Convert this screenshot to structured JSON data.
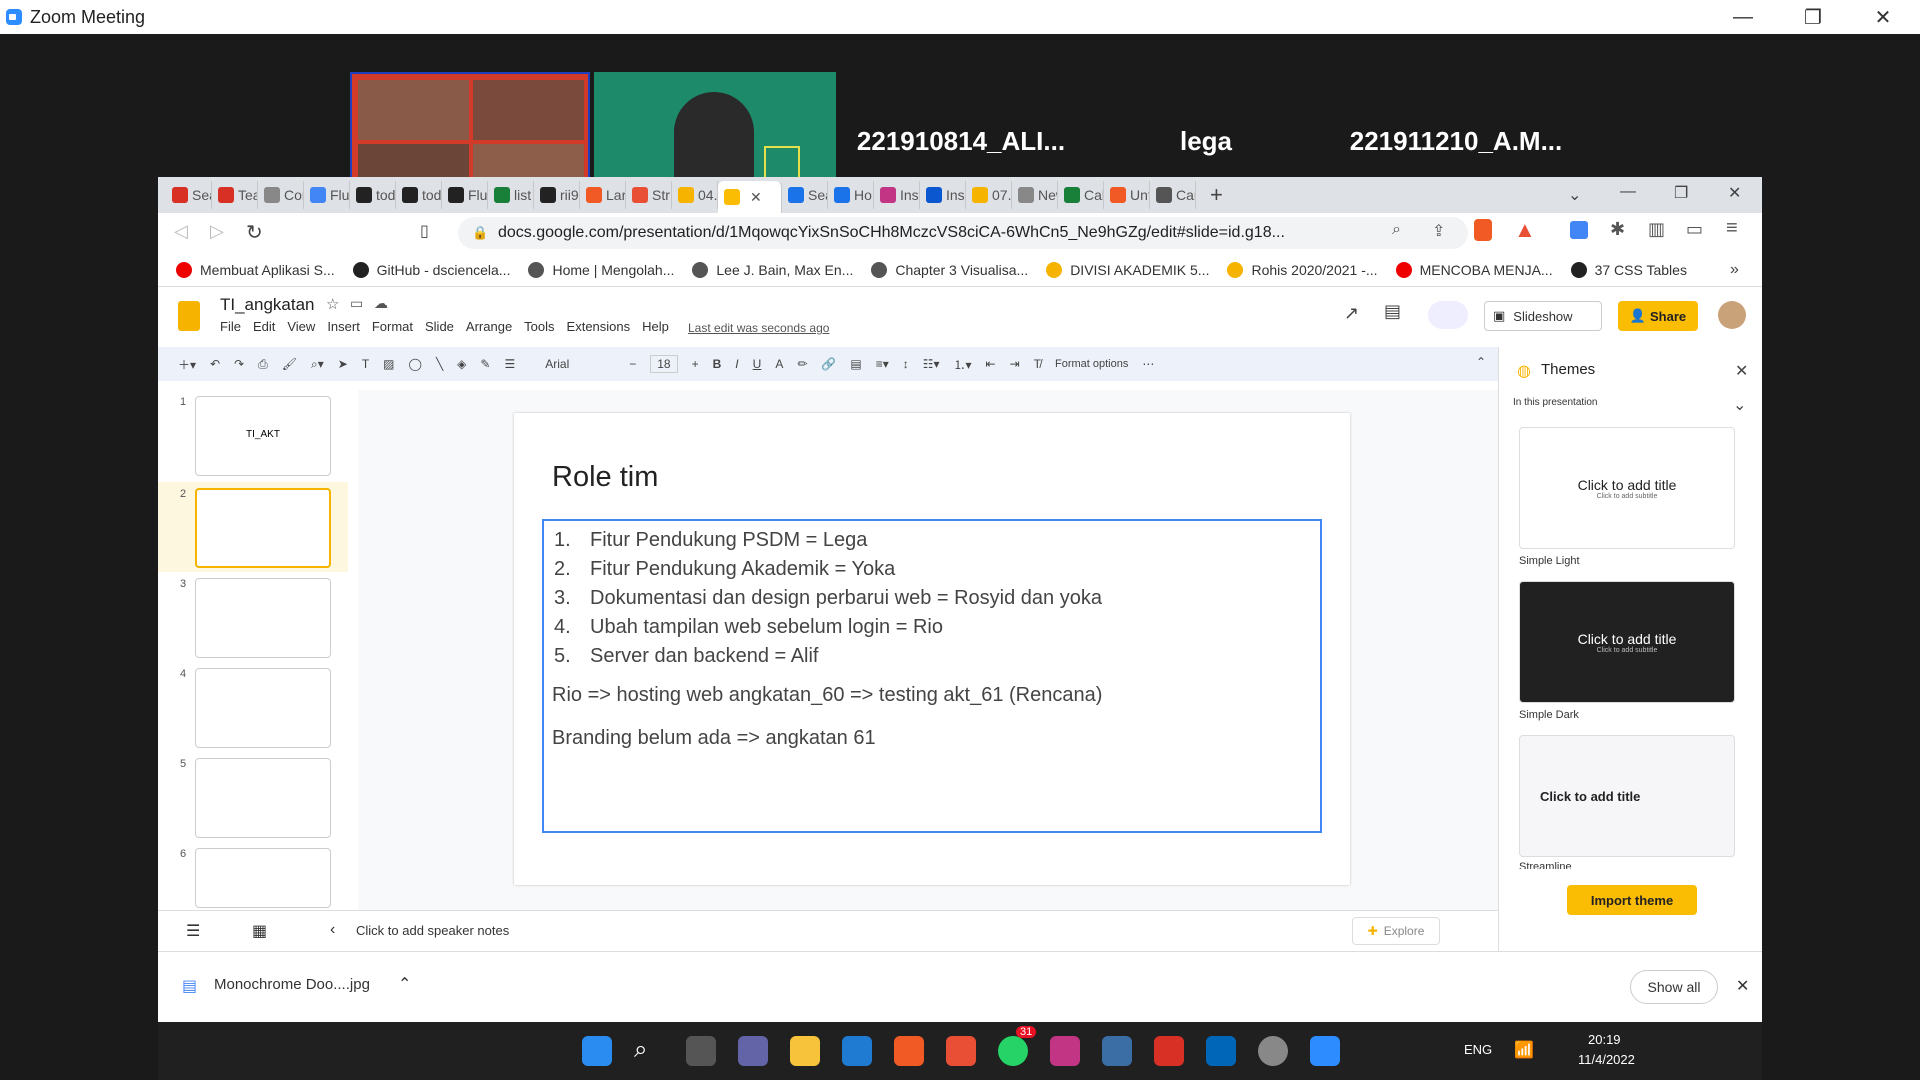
{
  "zoom": {
    "title": "Zoom Meeting",
    "participants": [
      "221910814_ALI...",
      "lega",
      "221911210_A.M..."
    ]
  },
  "browser": {
    "tabs": [
      "Sea",
      "Tea",
      "Cor",
      "Flu",
      "tod",
      "tod",
      "Flu",
      "list",
      "rii9",
      "Lar",
      "Str",
      "04.",
      "",
      "Sea",
      "Ho",
      "Inst",
      "Ins",
      "07.",
      "New Ta",
      "Cal",
      "Unt",
      "Car"
    ],
    "url": "docs.google.com/presentation/d/1MqowqcYixSnSoCHh8MczcVS8ciCA-6WhCn5_Ne9hGZg/edit#slide=id.g18...",
    "bookmarks": [
      "Membuat Aplikasi S...",
      "GitHub - dsciencela...",
      "Home | Mengolah...",
      "Lee J. Bain, Max En...",
      "Chapter 3 Visualisa...",
      "DIVISI AKADEMIK 5...",
      "Rohis 2020/2021 -...",
      "MENCOBA MENJA...",
      "37 CSS Tables"
    ]
  },
  "doc": {
    "title": "TI_angkatan",
    "menu": [
      "File",
      "Edit",
      "View",
      "Insert",
      "Format",
      "Slide",
      "Arrange",
      "Tools",
      "Extensions",
      "Help"
    ],
    "last_edit": "Last edit was seconds ago",
    "slideshow": "Slideshow",
    "share": "Share"
  },
  "toolbar": {
    "font": "Arial",
    "size": "18",
    "format_options": "Format options"
  },
  "slide": {
    "title": "Role tim",
    "list": [
      {
        "num": "1.",
        "text": "Fitur Pendukung PSDM = Lega"
      },
      {
        "num": "2.",
        "text": "Fitur Pendukung Akademik = Yoka"
      },
      {
        "num": "3.",
        "text": "Dokumentasi dan design perbarui web = Rosyid dan yoka"
      },
      {
        "num": "4.",
        "text": "Ubah tampilan web sebelum login = Rio"
      },
      {
        "num": "5.",
        "text": "Server dan backend = Alif"
      }
    ],
    "line1": "Rio => hosting web angkatan_60 => testing akt_61 (Rencana)",
    "line2": "Branding belum ada => angkatan 61"
  },
  "thumbs": {
    "nums": [
      "1",
      "2",
      "3",
      "4",
      "5",
      "6"
    ],
    "first": "TI_AKT"
  },
  "notes": "Click to add speaker notes",
  "explore": "Explore",
  "themes": {
    "title": "Themes",
    "filter": "In this presentation",
    "card_title": "Click to add title",
    "card_sub": "Click to add subtitle",
    "names": [
      "Simple Light",
      "Simple Dark",
      "Streamline"
    ],
    "import": "Import theme"
  },
  "download": {
    "file": "Monochrome Doo....jpg",
    "show_all": "Show all"
  },
  "taskbar": {
    "lang": "ENG",
    "time": "20:19",
    "date": "11/4/2022",
    "badge": "31"
  }
}
